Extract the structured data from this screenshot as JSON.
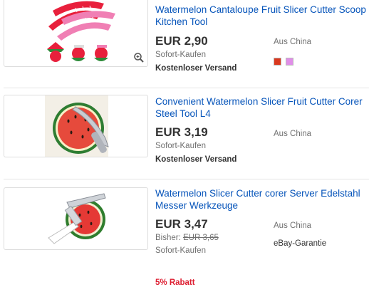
{
  "listings": [
    {
      "title": "Watermelon Cantaloupe Fruit Slicer Cutter Scoop Kitchen Tool",
      "price": "EUR 2,90",
      "buy_format": "Sofort-Kaufen",
      "shipping": "Kostenloser Versand",
      "origin": "Aus China",
      "swatch_colors": [
        "#d9381e",
        "#e08ee8"
      ],
      "thumb_icon": "zoom-icon"
    },
    {
      "title": "Convenient Watermelon Slicer Fruit Cutter Corer Steel Tool L4",
      "price": "EUR 3,19",
      "buy_format": "Sofort-Kaufen",
      "shipping": "Kostenloser Versand",
      "origin": "Aus China"
    },
    {
      "title": "Watermelon Slicer Cutter corer Server Edelstahl Messer Werkzeuge",
      "price": "EUR 3,47",
      "previous_label": "Bisher:",
      "previous_price": "EUR 3,65",
      "buy_format": "Sofort-Kaufen",
      "discount": "5% Rabatt",
      "origin": "Aus China",
      "guarantee": "eBay-Garantie"
    }
  ],
  "colors": {
    "link": "#0654ba",
    "discount": "#dd1e31",
    "muted": "#707070"
  }
}
